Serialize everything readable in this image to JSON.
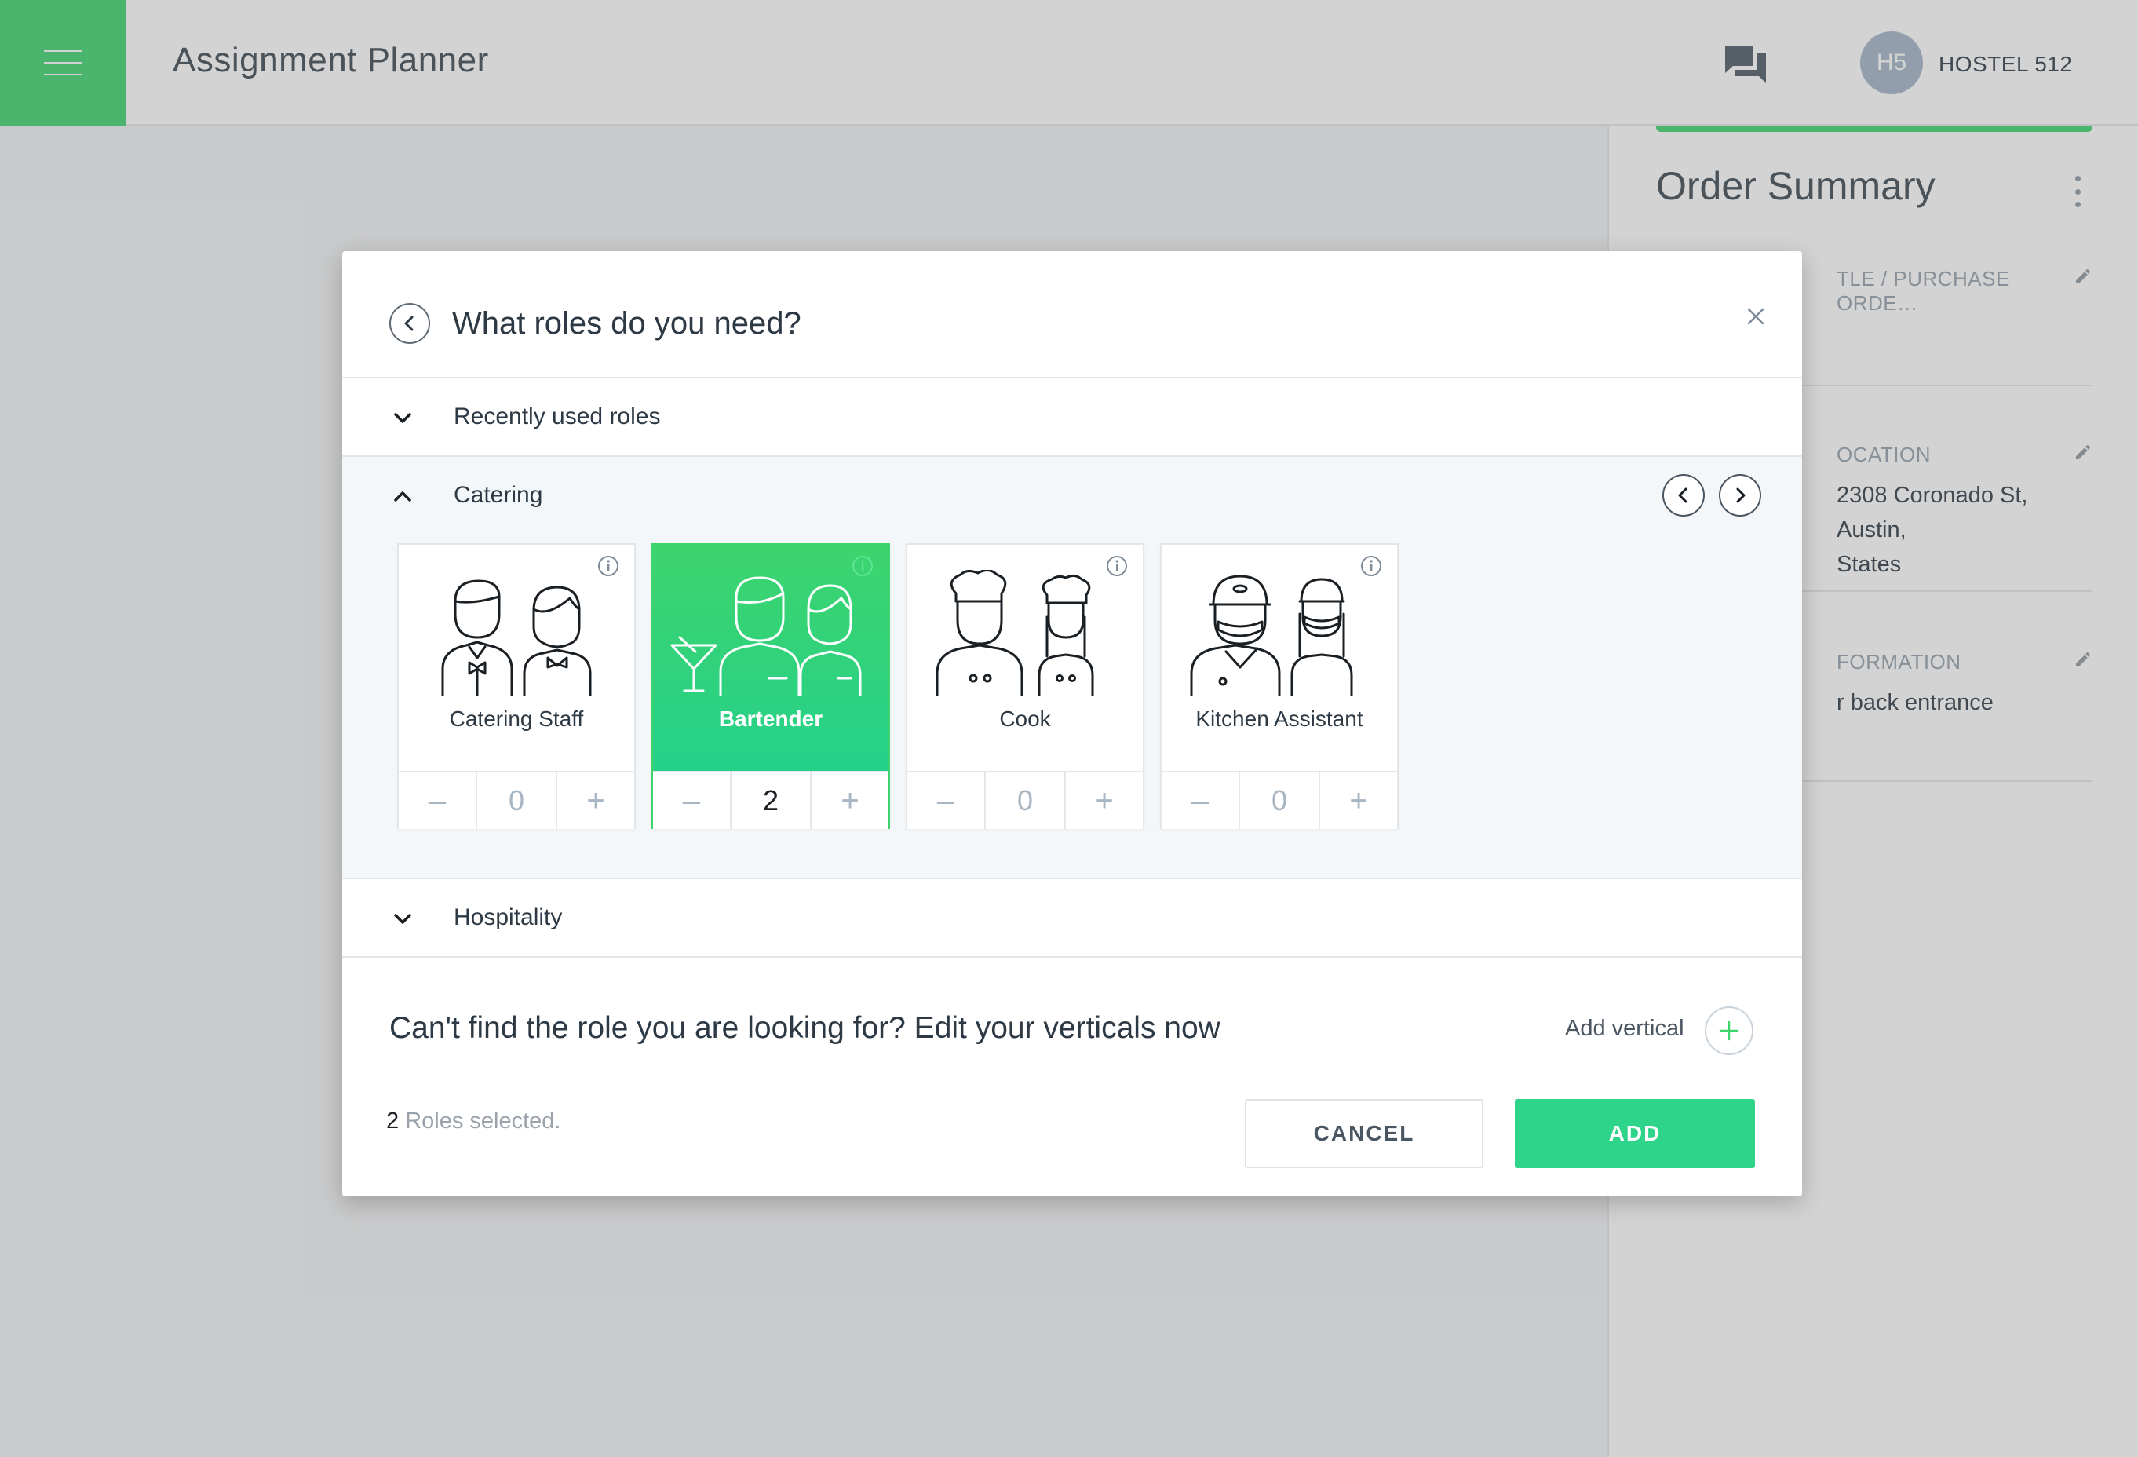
{
  "header": {
    "app_title": "Assignment Planner",
    "account": {
      "initials": "H5",
      "name": "HOSTEL 512"
    }
  },
  "order_summary": {
    "title": "Order Summary",
    "sections": [
      {
        "label": "TLE / PURCHASE ORDE…",
        "value": ""
      },
      {
        "label": "OCATION",
        "value_lines": [
          "2308 Coronado St, Austin,",
          "States"
        ]
      },
      {
        "label": "FORMATION",
        "value": "r back entrance"
      }
    ]
  },
  "modal": {
    "title": "What roles do you need?",
    "groups": {
      "recent": "Recently used roles",
      "catering": "Catering",
      "hospitality": "Hospitality"
    },
    "roles": [
      {
        "name": "Catering Staff",
        "count": "0",
        "selected": false
      },
      {
        "name": "Bartender",
        "count": "2",
        "selected": true
      },
      {
        "name": "Cook",
        "count": "0",
        "selected": false
      },
      {
        "name": "Kitchen Assistant",
        "count": "0",
        "selected": false
      }
    ],
    "stepper": {
      "minus": "–",
      "plus": "+"
    },
    "hint": "Can't find the role you are looking for? Edit your verticals now",
    "add_vertical": "Add vertical",
    "selected_count": "2",
    "selected_suffix": " Roles selected.",
    "cancel_label": "CANCEL",
    "add_label": "ADD"
  },
  "colors": {
    "accent": "#3dd46e",
    "add_button": "#2ed48a"
  }
}
